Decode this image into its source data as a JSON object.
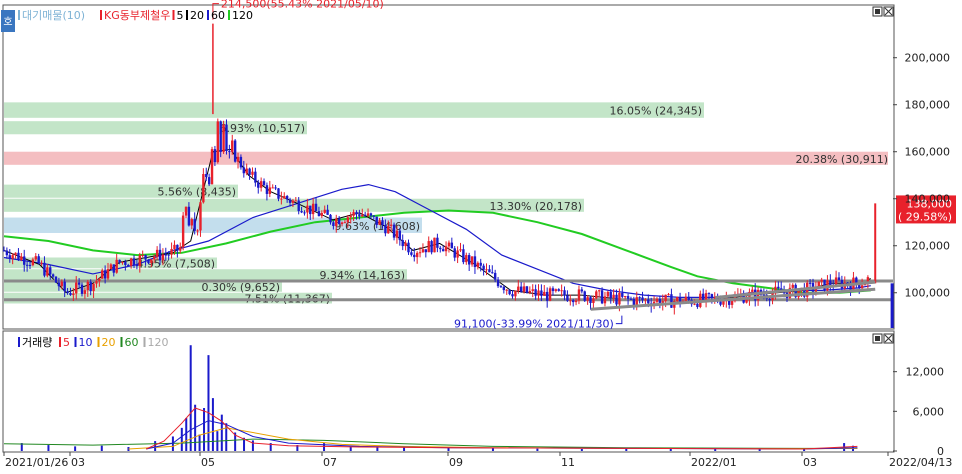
{
  "chart_data": [
    {
      "type": "candlestick",
      "panel": "price",
      "legend": [
        {
          "label": "대기매물(10)",
          "color": "#7fb3d5"
        },
        {
          "label": "KG동부제철우",
          "color": "#e8212b"
        },
        {
          "label": "5",
          "color": "#e8212b"
        },
        {
          "label": "20",
          "color": "#000000"
        },
        {
          "label": "60",
          "color": "#1a1acb"
        },
        {
          "label": "120",
          "color": "#22cc22"
        }
      ],
      "y_axis": {
        "min": 85000,
        "max": 222000,
        "ticks": [
          100000,
          120000,
          140000,
          160000,
          180000,
          200000
        ],
        "tick_labels": [
          "100,000",
          "120,000",
          "140,000",
          "160,000",
          "180,000",
          "200,000"
        ]
      },
      "x_axis": {
        "start": "2021/01/26",
        "end": "2022/04/13",
        "tick_labels": [
          "2021/01/26",
          "03",
          "05",
          "07",
          "09",
          "11",
          "2022/01",
          "03",
          "2022/04/13"
        ]
      },
      "volume_profile_bands": [
        {
          "label": "7.51% (11,367)",
          "low": 95000,
          "high": 100000,
          "color": "green"
        },
        {
          "label": "0.30% (9,652)",
          "low": 100000,
          "high": 105000,
          "color": "green"
        },
        {
          "label": "9.34% (14,163)",
          "low": 105000,
          "high": 110000,
          "color": "green"
        },
        {
          "label": "4.95% (7,508)",
          "low": 110000,
          "high": 115000,
          "color": "green"
        },
        {
          "label": "9.63% (14,608)",
          "low": 125000,
          "high": 132000,
          "color": "blue"
        },
        {
          "label": "13.30% (20,178)",
          "low": 134000,
          "high": 140000,
          "color": "green"
        },
        {
          "label": "5.56% (8,435)",
          "low": 140000,
          "high": 146000,
          "color": "green"
        },
        {
          "label": "20.38% (30,911)",
          "low": 154000,
          "high": 160000,
          "color": "red"
        },
        {
          "label": "6.93% (10,517)",
          "low": 167000,
          "high": 173000,
          "color": "green"
        },
        {
          "label": "16.05% (24,345)",
          "low": 174000,
          "high": 181000,
          "color": "green"
        }
      ],
      "annotations": [
        {
          "label": "214,500(55.43% 2021/05/10)",
          "date": "2021/05/10",
          "value": 214500
        },
        {
          "label": "91,100(-33.99% 2021/11/30)",
          "date": "2021/11/30",
          "value": 91100
        }
      ],
      "last_price": {
        "value": 138000,
        "label": "138,000",
        "change_label": "( 29.58%)"
      },
      "ma20_points": [
        [
          0,
          118000
        ],
        [
          0.04,
          112000
        ],
        [
          0.07,
          100000
        ],
        [
          0.1,
          104000
        ],
        [
          0.13,
          113000
        ],
        [
          0.16,
          115000
        ],
        [
          0.19,
          117000
        ],
        [
          0.21,
          122000
        ],
        [
          0.235,
          160000
        ],
        [
          0.255,
          161000
        ],
        [
          0.275,
          150000
        ],
        [
          0.3,
          143000
        ],
        [
          0.33,
          138000
        ],
        [
          0.37,
          131000
        ],
        [
          0.4,
          134000
        ],
        [
          0.43,
          128000
        ],
        [
          0.46,
          118000
        ],
        [
          0.49,
          121000
        ],
        [
          0.53,
          112000
        ],
        [
          0.57,
          101000
        ],
        [
          0.61,
          99000
        ],
        [
          0.65,
          99000
        ],
        [
          0.7,
          97000
        ],
        [
          0.75,
          96500
        ],
        [
          0.8,
          97000
        ],
        [
          0.84,
          99000
        ],
        [
          0.87,
          100000
        ],
        [
          0.9,
          101000
        ],
        [
          0.93,
          104000
        ],
        [
          0.96,
          104000
        ],
        [
          0.975,
          106000
        ]
      ],
      "ma60_points": [
        [
          0,
          115000
        ],
        [
          0.05,
          112000
        ],
        [
          0.1,
          108000
        ],
        [
          0.15,
          112000
        ],
        [
          0.19,
          118000
        ],
        [
          0.23,
          122000
        ],
        [
          0.28,
          132000
        ],
        [
          0.33,
          138000
        ],
        [
          0.38,
          144000
        ],
        [
          0.41,
          146000
        ],
        [
          0.44,
          143000
        ],
        [
          0.48,
          135000
        ],
        [
          0.52,
          127000
        ],
        [
          0.56,
          116000
        ],
        [
          0.6,
          110000
        ],
        [
          0.64,
          104000
        ],
        [
          0.68,
          101000
        ],
        [
          0.72,
          99000
        ],
        [
          0.76,
          98000
        ],
        [
          0.8,
          98000
        ],
        [
          0.84,
          100000
        ],
        [
          0.88,
          101000
        ],
        [
          0.92,
          101000
        ],
        [
          0.96,
          102000
        ],
        [
          0.975,
          103000
        ]
      ],
      "ma120_points": [
        [
          0,
          124000
        ],
        [
          0.05,
          122000
        ],
        [
          0.1,
          118000
        ],
        [
          0.15,
          116000
        ],
        [
          0.2,
          117000
        ],
        [
          0.25,
          121000
        ],
        [
          0.3,
          126000
        ],
        [
          0.35,
          130000
        ],
        [
          0.4,
          132000
        ],
        [
          0.45,
          134000
        ],
        [
          0.5,
          135000
        ],
        [
          0.55,
          134000
        ],
        [
          0.6,
          130000
        ],
        [
          0.65,
          125000
        ],
        [
          0.7,
          118000
        ],
        [
          0.75,
          111000
        ],
        [
          0.78,
          107000
        ],
        [
          0.82,
          104000
        ],
        [
          0.86,
          102000
        ],
        [
          0.9,
          100000
        ],
        [
          0.94,
          100000
        ],
        [
          0.975,
          101000
        ]
      ],
      "trendlines": [
        {
          "from": [
            0.66,
            93000
          ],
          "to": [
            0.98,
            101500
          ]
        },
        {
          "from": [
            0.8,
            98000
          ],
          "to": [
            0.98,
            104500
          ]
        }
      ]
    },
    {
      "type": "bar",
      "panel": "volume",
      "legend": [
        {
          "label": "거래량",
          "color": "#1a1acb"
        },
        {
          "label": "5",
          "color": "#e8212b"
        },
        {
          "label": "10",
          "color": "#1a1acb"
        },
        {
          "label": "20",
          "color": "#e8a000"
        },
        {
          "label": "60",
          "color": "#228822"
        },
        {
          "label": "120",
          "color": "#aaaaaa"
        }
      ],
      "y_axis": {
        "min": 0,
        "max": 18000,
        "ticks": [
          0,
          6000,
          12000
        ],
        "tick_labels": [
          "0",
          "6,000",
          "12,000"
        ]
      },
      "bars": [
        [
          0.02,
          1200
        ],
        [
          0.05,
          900
        ],
        [
          0.08,
          700
        ],
        [
          0.11,
          800
        ],
        [
          0.14,
          600
        ],
        [
          0.17,
          1500
        ],
        [
          0.19,
          2200
        ],
        [
          0.2,
          3500
        ],
        [
          0.205,
          5000
        ],
        [
          0.21,
          16000
        ],
        [
          0.215,
          7000
        ],
        [
          0.22,
          2500
        ],
        [
          0.225,
          6500
        ],
        [
          0.23,
          14500
        ],
        [
          0.235,
          8000
        ],
        [
          0.24,
          3000
        ],
        [
          0.245,
          5500
        ],
        [
          0.25,
          4200
        ],
        [
          0.26,
          2800
        ],
        [
          0.27,
          2000
        ],
        [
          0.28,
          1600
        ],
        [
          0.3,
          1200
        ],
        [
          0.33,
          900
        ],
        [
          0.36,
          1200
        ],
        [
          0.39,
          800
        ],
        [
          0.42,
          700
        ],
        [
          0.45,
          600
        ],
        [
          0.5,
          500
        ],
        [
          0.55,
          400
        ],
        [
          0.6,
          350
        ],
        [
          0.65,
          300
        ],
        [
          0.7,
          350
        ],
        [
          0.75,
          400
        ],
        [
          0.8,
          300
        ],
        [
          0.85,
          280
        ],
        [
          0.9,
          300
        ],
        [
          0.945,
          1200
        ],
        [
          0.955,
          800
        ]
      ],
      "ma5_points": [
        [
          0.16,
          300
        ],
        [
          0.18,
          1500
        ],
        [
          0.2,
          4200
        ],
        [
          0.215,
          6500
        ],
        [
          0.23,
          5800
        ],
        [
          0.245,
          4500
        ],
        [
          0.26,
          2400
        ],
        [
          0.28,
          1200
        ],
        [
          0.32,
          800
        ],
        [
          0.4,
          600
        ],
        [
          0.5,
          500
        ],
        [
          0.7,
          400
        ],
        [
          0.9,
          300
        ],
        [
          0.96,
          700
        ]
      ],
      "ma10_points": [
        [
          0.16,
          300
        ],
        [
          0.19,
          1200
        ],
        [
          0.21,
          3200
        ],
        [
          0.23,
          4600
        ],
        [
          0.25,
          4000
        ],
        [
          0.28,
          2200
        ],
        [
          0.32,
          1200
        ],
        [
          0.4,
          700
        ],
        [
          0.5,
          500
        ],
        [
          0.7,
          400
        ],
        [
          0.9,
          300
        ],
        [
          0.96,
          500
        ]
      ],
      "ma20_points": [
        [
          0.14,
          300
        ],
        [
          0.19,
          700
        ],
        [
          0.22,
          2400
        ],
        [
          0.25,
          3500
        ],
        [
          0.28,
          2800
        ],
        [
          0.32,
          1800
        ],
        [
          0.38,
          1000
        ],
        [
          0.45,
          700
        ],
        [
          0.55,
          500
        ],
        [
          0.7,
          400
        ],
        [
          0.9,
          350
        ],
        [
          0.96,
          400
        ]
      ],
      "ma60_points": [
        [
          0.0,
          1100
        ],
        [
          0.1,
          900
        ],
        [
          0.2,
          1200
        ],
        [
          0.28,
          1800
        ],
        [
          0.36,
          1600
        ],
        [
          0.45,
          1100
        ],
        [
          0.55,
          700
        ],
        [
          0.7,
          500
        ],
        [
          0.9,
          400
        ],
        [
          0.96,
          400
        ]
      ]
    }
  ]
}
